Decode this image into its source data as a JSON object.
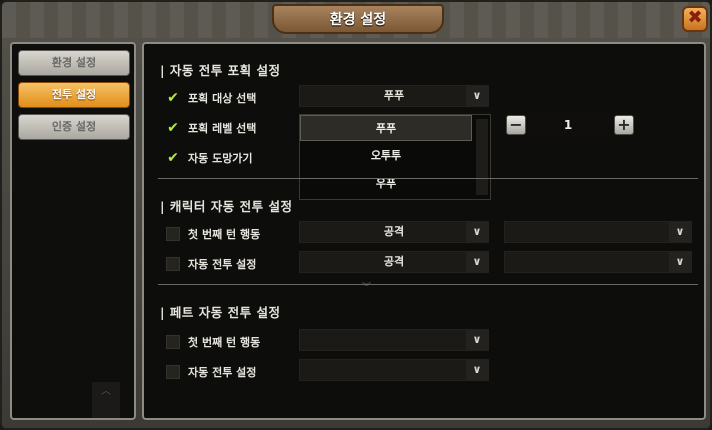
{
  "window": {
    "title": "환경 설정",
    "close_symbol": "✖"
  },
  "sidebar": {
    "items": [
      {
        "label": "환경 설정",
        "active": false
      },
      {
        "label": "전투 설정",
        "active": true
      },
      {
        "label": "인증 설정",
        "active": false
      }
    ],
    "scroll_symbol": "︿"
  },
  "auto_capture": {
    "title": "| 자동 전투 포획 설정",
    "target": {
      "label": "포획 대상 선택",
      "value": "푸푸",
      "checked": true
    },
    "level": {
      "label": "포획 레벨 선택",
      "checked": true,
      "value": "1",
      "minus": "−",
      "plus": "+"
    },
    "auto_flee": {
      "label": "자동 도망가기",
      "checked": true
    },
    "dropdown_options": [
      "푸푸",
      "오투투",
      "우푸"
    ]
  },
  "character_auto": {
    "title": "| 캐릭터 자동 전투 설정",
    "first_turn": {
      "label": "첫 번째 턴 행동",
      "value": "공격",
      "value2": "",
      "checked": false
    },
    "auto_battle": {
      "label": "자동 전투 설정",
      "value": "공격",
      "value2": "",
      "checked": false
    }
  },
  "pet_auto": {
    "title": "| 페트 자동 전투 설정",
    "first_turn": {
      "label": "첫 번째 턴 행동",
      "value": "",
      "checked": false
    },
    "auto_battle": {
      "label": "자동 전투 설정",
      "value": "",
      "checked": false
    }
  },
  "icons": {
    "check": "✔",
    "chevron": "∨",
    "divider_chevron": "︾"
  }
}
